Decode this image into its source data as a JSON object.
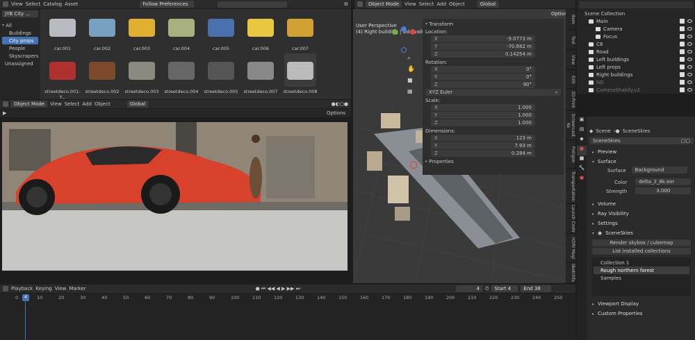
{
  "asset_browser": {
    "menu": [
      "View",
      "Select",
      "Catalog",
      "Asset"
    ],
    "library": "JYB City ...",
    "import_mode": "Follow Preferences",
    "categories": [
      "All",
      "Buildings",
      "City props",
      "People",
      "Skyscrapers",
      "Unassigned"
    ],
    "selected_category": "City props",
    "assets_row1": [
      "car.001",
      "car.002",
      "car.003",
      "car.004",
      "car.005",
      "car.006",
      "car.007"
    ],
    "assets_row2": [
      "streetdeco.001-Y...",
      "streetdeco.002",
      "streetdeco.003",
      "streetdeco.004",
      "streetdeco.005",
      "streetdeco.007",
      "streetdeco.008"
    ]
  },
  "render_view": {
    "mode": "Object Mode",
    "menu": [
      "View",
      "Select",
      "Add",
      "Object"
    ],
    "orientation": "Global",
    "options": "Options"
  },
  "viewport3d": {
    "mode": "Object Mode",
    "menu": [
      "View",
      "Select",
      "Add",
      "Object"
    ],
    "orientation": "Global",
    "options": "Options",
    "perspective": "User Perspective",
    "object_info": "(4) Right building | sidewalk.001"
  },
  "transform": {
    "title": "Transform",
    "location_label": "Location:",
    "location": [
      {
        "axis": "X",
        "value": "-9.0773 m"
      },
      {
        "axis": "Y",
        "value": "-70.682 m"
      },
      {
        "axis": "Z",
        "value": "0.14254 m"
      }
    ],
    "rotation_label": "Rotation:",
    "rotation": [
      {
        "axis": "X",
        "value": "0°"
      },
      {
        "axis": "Y",
        "value": "0°"
      },
      {
        "axis": "Z",
        "value": "90°"
      }
    ],
    "rotation_mode": "XYZ Euler",
    "scale_label": "Scale:",
    "scale": [
      {
        "axis": "X",
        "value": "1.000"
      },
      {
        "axis": "Y",
        "value": "1.000"
      },
      {
        "axis": "Z",
        "value": "1.000"
      }
    ],
    "dimensions_label": "Dimensions:",
    "dimensions": [
      {
        "axis": "X",
        "value": "123 m"
      },
      {
        "axis": "Y",
        "value": "7.93 m"
      },
      {
        "axis": "Z",
        "value": "0.284 m"
      }
    ],
    "properties": "Properties"
  },
  "sidebar_tabs": [
    "Item",
    "Tool",
    "View",
    "Edit",
    "3D-Print",
    "Screencast Ke",
    "Poliigon",
    "Transportation",
    "Launch Contr",
    "HDRI Magi",
    "Sketchfa"
  ],
  "outliner": {
    "root": "Scene Collection",
    "items": [
      {
        "name": "Main",
        "indent": 0,
        "dim": false
      },
      {
        "name": "Camera",
        "indent": 1,
        "dim": false
      },
      {
        "name": "Focus",
        "indent": 1,
        "dim": false
      },
      {
        "name": "C8",
        "indent": 0,
        "dim": false
      },
      {
        "name": "Road",
        "indent": 0,
        "dim": false
      },
      {
        "name": "Left buildings",
        "indent": 0,
        "dim": false
      },
      {
        "name": "Left props",
        "indent": 0,
        "dim": false
      },
      {
        "name": "Right buildings",
        "indent": 0,
        "dim": false
      },
      {
        "name": "ND",
        "indent": 0,
        "dim": true
      },
      {
        "name": "CameraShakify.v2",
        "indent": 0,
        "dim": true
      }
    ]
  },
  "properties_panel": {
    "breadcrumb_scene": "Scene",
    "breadcrumb_world": "SceneSkies",
    "world_name": "SceneSkies",
    "preview": "Preview",
    "surface": "Surface",
    "surface_label": "Surface",
    "surface_value": "Background",
    "color_label": "Color",
    "color_value": "delta_2_8k.exr",
    "strength_label": "Strength",
    "strength_value": "3.000",
    "volume": "Volume",
    "ray_visibility": "Ray Visibility",
    "settings": "Settings",
    "sceneskies": "SceneSkies",
    "render_button": "Render skybox / cubemap",
    "list_button": "List installed collections",
    "collections": [
      "Collection 1",
      "Rough northern forest",
      "Samples"
    ],
    "viewport_display": "Viewport Display",
    "custom_properties": "Custom Properties"
  },
  "timeline": {
    "menu": [
      "Playback",
      "Keying",
      "View",
      "Marker"
    ],
    "current_frame": "4",
    "start_label": "Start",
    "start": "4",
    "end_label": "End",
    "end": "38",
    "ticks": [
      "0",
      "10",
      "20",
      "30",
      "40",
      "50",
      "60",
      "70",
      "80",
      "90",
      "100",
      "110",
      "120",
      "130",
      "140",
      "150",
      "160",
      "170",
      "180",
      "190",
      "200",
      "210",
      "220",
      "230",
      "240",
      "250"
    ]
  },
  "colors": {
    "accent": "#4772b3",
    "panel": "#2b2b2b",
    "bg": "#1d1d1d",
    "selected": "#3f5d8a"
  }
}
